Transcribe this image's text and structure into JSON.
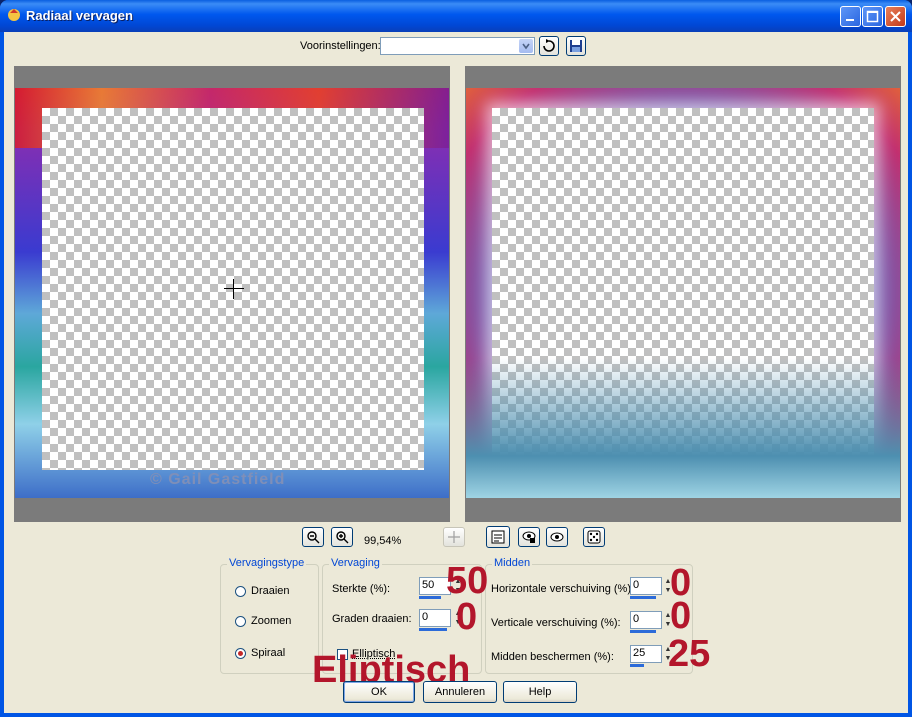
{
  "window": {
    "title": "Radiaal vervagen",
    "minimize_icon": "minimize-icon",
    "maximize_icon": "maximize-icon",
    "close_icon": "close-icon"
  },
  "presets": {
    "label": "Voorinstellingen:",
    "value": "",
    "reset_icon": "reset-icon",
    "save_icon": "save-icon"
  },
  "preview": {
    "watermark": "© Gail Gastfield"
  },
  "zoom": {
    "zoom_out_icon": "zoom-out-icon",
    "zoom_in_icon": "zoom-in-icon",
    "value": "99,54%"
  },
  "tools": {
    "move_icon": "move-icon",
    "proof_icon": "proof-icon",
    "auto_proof_icon": "auto-proof-icon",
    "eye_icon": "eye-icon",
    "randomize_icon": "randomize-icon"
  },
  "blur_type": {
    "title": "Vervagingstype",
    "options": [
      {
        "label": "Draaien",
        "checked": false
      },
      {
        "label": "Zoomen",
        "checked": false
      },
      {
        "label": "Spiraal",
        "checked": true
      }
    ]
  },
  "blur": {
    "title": "Vervaging",
    "strength_label": "Sterkte (%):",
    "strength_value": "50",
    "strength_big": "50",
    "rotate_label": "Graden draaien:",
    "rotate_value": "0",
    "rotate_big": "0",
    "elliptic_label": "Elliptisch",
    "elliptic_checked": false,
    "elliptic_big": "Eliptisch"
  },
  "center": {
    "title": "Midden",
    "h_offset_label": "Horizontale verschuiving (%):",
    "h_offset_value": "0",
    "h_offset_big": "0",
    "v_offset_label": "Verticale verschuiving (%):",
    "v_offset_value": "0",
    "v_offset_big": "0",
    "protect_label": "Midden beschermen (%):",
    "protect_value": "25",
    "protect_big": "25"
  },
  "buttons": {
    "ok": "OK",
    "cancel": "Annuleren",
    "help": "Help"
  }
}
